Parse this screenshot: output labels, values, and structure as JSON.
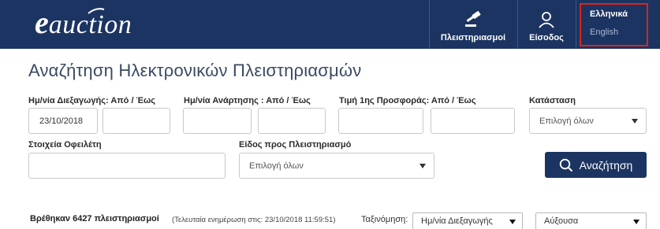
{
  "header": {
    "logo": {
      "first": "e",
      "rest": "auction"
    },
    "nav": {
      "auctions_label": "Πλειστηριασμοί",
      "login_label": "Είσοδος"
    },
    "language": {
      "greek": "Ελληνικά",
      "english": "English"
    }
  },
  "page": {
    "title": "Αναζήτηση Ηλεκτρονικών Πλειστηριασμών"
  },
  "filters": {
    "conduct_date": {
      "label": "Ημ/νία Διεξαγωγής:",
      "range": "Από / Έως",
      "from_value": "23/10/2018",
      "to_value": ""
    },
    "post_date": {
      "label": "Ημ/νία Ανάρτησης :",
      "range": "Από / Έως",
      "from_value": "",
      "to_value": ""
    },
    "first_bid": {
      "label": "Τιμή 1ης Προσφοράς:",
      "range": "Από / Έως",
      "from_value": "",
      "to_value": ""
    },
    "status": {
      "label": "Κατάσταση",
      "value": "Επιλογή όλων"
    },
    "debtor": {
      "label": "Στοιχεία Οφειλέτη",
      "value": ""
    },
    "item_type": {
      "label": "Είδος προς Πλειστηριασμό",
      "value": "Επιλογή όλων"
    },
    "search_button": "Αναζήτηση"
  },
  "results": {
    "count_text": "Βρέθηκαν 6427 πλειστηριασμοί",
    "last_update": "(Τελευταία ενημέρωση στις: 23/10/2018 11:59:51)",
    "sort_label": "Ταξινόμηση:",
    "sort_field": "Ημ/νία Διεξαγωγής",
    "sort_order": "Αύξουσα"
  },
  "colors": {
    "header_bg": "#1c3461",
    "language_highlight": "#d7261e",
    "title_text": "#3a4a63"
  },
  "icons": {
    "auctions": "gavel-icon",
    "login": "user-icon",
    "search": "search-icon",
    "dropdown": "chevron-down-icon"
  }
}
